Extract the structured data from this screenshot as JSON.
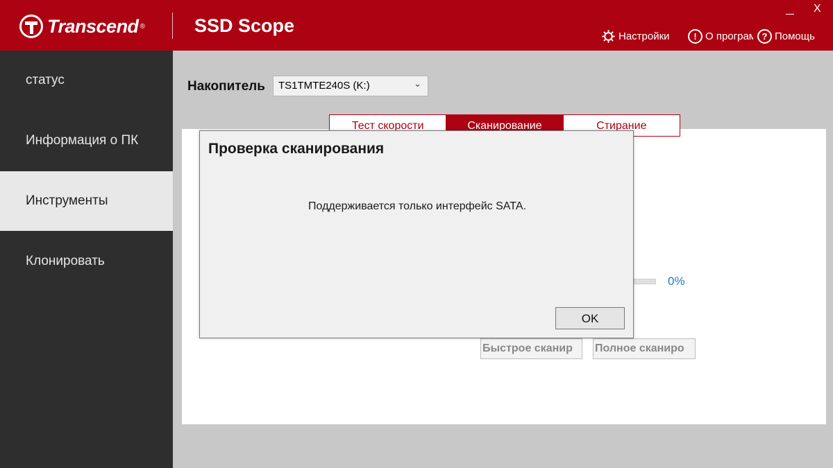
{
  "header": {
    "brand": "Transcend",
    "brand_mark": "®",
    "app_title": "SSD Scope",
    "window": {
      "minimize": "_",
      "close": "X"
    },
    "links": [
      {
        "label": "Настройки",
        "icon": "gear-icon"
      },
      {
        "label": "О програм",
        "icon": "info-icon"
      },
      {
        "label": "Помощь",
        "icon": "help-icon"
      }
    ],
    "accent_color": "#ad0212"
  },
  "sidebar": {
    "items": [
      {
        "label": "статус",
        "active": false
      },
      {
        "label": "Информация о ПК",
        "active": false
      },
      {
        "label": "Инструменты",
        "active": true
      },
      {
        "label": "Клонировать",
        "active": false
      }
    ]
  },
  "main": {
    "drive_label": "Накопитель",
    "drive_value": "TS1TMTE240S (K:)",
    "tabs": [
      {
        "label": "Тест скорости",
        "active": false
      },
      {
        "label": "Сканирование",
        "active": true
      },
      {
        "label": "Стирание",
        "active": false
      }
    ],
    "progress": {
      "percent": 0,
      "label": "0%"
    },
    "quick_scan_label": "Быстрое сканир",
    "full_scan_label": "Полное сканиро"
  },
  "modal": {
    "title": "Проверка сканирования",
    "message": "Поддерживается только интерфейс SATA.",
    "ok_label": "OK"
  }
}
